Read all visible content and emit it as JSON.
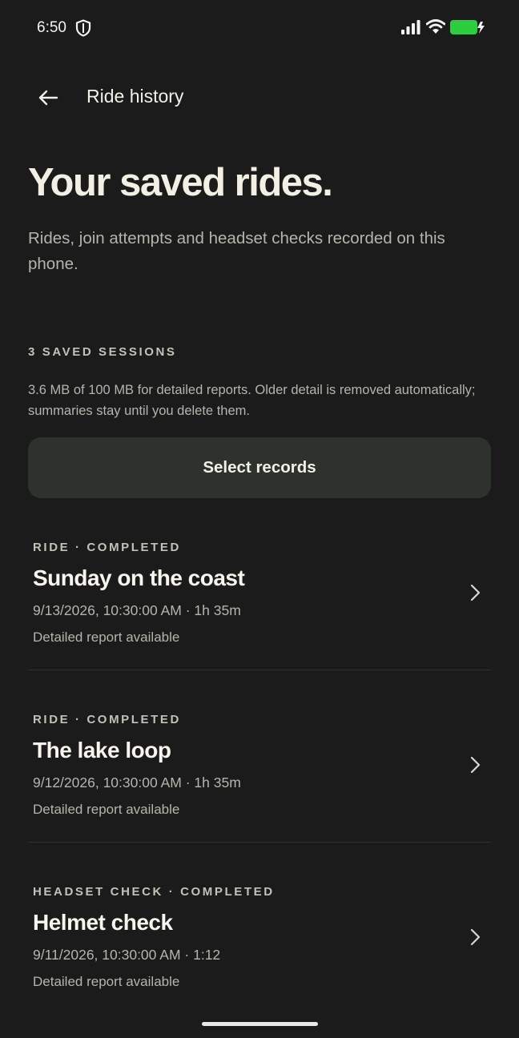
{
  "status_bar": {
    "time": "6:50",
    "battery_color": "#2ecc40"
  },
  "app_bar": {
    "title": "Ride history",
    "back_icon": "arrow-left-icon"
  },
  "hero": {
    "title": "Your saved rides.",
    "subtitle": "Rides, join attempts and headset checks recorded on this phone."
  },
  "sessions": {
    "label": "3 SAVED SESSIONS",
    "storage_note": "3.6 MB of 100 MB for detailed reports. Older detail is removed automatically; summaries stay until you delete them."
  },
  "select_button": {
    "label": "Select records"
  },
  "records": [
    {
      "kind": "RIDE · COMPLETED",
      "title": "Sunday on the coast",
      "meta": "9/13/2026, 10:30:00 AM · 1h 35m",
      "detail": "Detailed report available"
    },
    {
      "kind": "RIDE · COMPLETED",
      "title": "The lake loop",
      "meta": "9/12/2026, 10:30:00 AM · 1h 35m",
      "detail": "Detailed report available"
    },
    {
      "kind": "HEADSET CHECK · COMPLETED",
      "title": "Helmet check",
      "meta": "9/11/2026, 10:30:00 AM · 1:12",
      "detail": "Detailed report available"
    }
  ]
}
